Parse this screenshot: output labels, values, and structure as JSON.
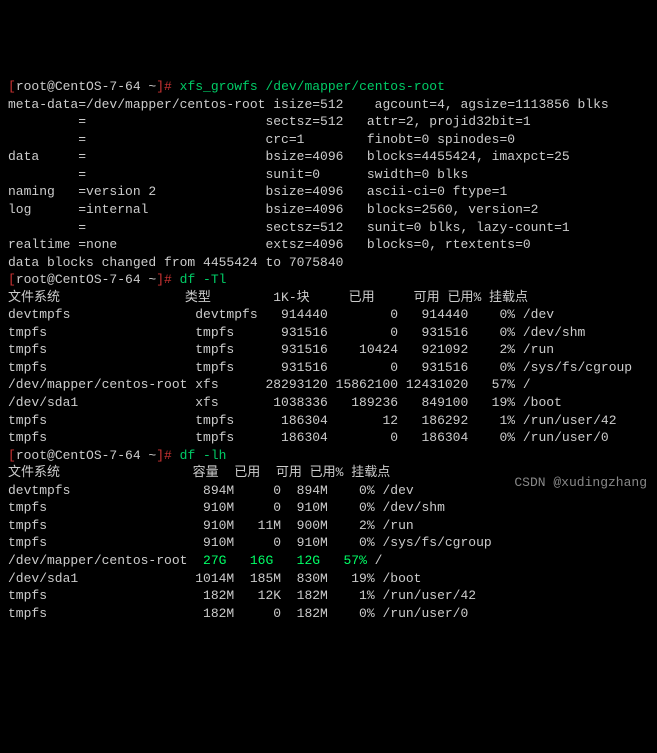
{
  "prompt": {
    "open": "[",
    "user_host": "root@CentOS-7-64 ~",
    "close": "]# "
  },
  "cmd1": "xfs_growfs /dev/mapper/centos-root",
  "xfs_out": "meta-data=/dev/mapper/centos-root isize=512    agcount=4, agsize=1113856 blks\n         =                       sectsz=512   attr=2, projid32bit=1\n         =                       crc=1        finobt=0 spinodes=0\ndata     =                       bsize=4096   blocks=4455424, imaxpct=25\n         =                       sunit=0      swidth=0 blks\nnaming   =version 2              bsize=4096   ascii-ci=0 ftype=1\nlog      =internal               bsize=4096   blocks=2560, version=2\n         =                       sectsz=512   sunit=0 blks, lazy-count=1\nrealtime =none                   extsz=4096   blocks=0, rtextents=0\ndata blocks changed from 4455424 to 7075840",
  "cmd2": "df -Tl",
  "df1_header": "文件系统                类型        1K-块     已用     可用 已用% 挂载点",
  "df1_rows": "devtmpfs                devtmpfs   914440        0   914440    0% /dev\ntmpfs                   tmpfs      931516        0   931516    0% /dev/shm\ntmpfs                   tmpfs      931516    10424   921092    2% /run\ntmpfs                   tmpfs      931516        0   931516    0% /sys/fs/cgroup\n/dev/mapper/centos-root xfs      28293120 15862100 12431020   57% /\n/dev/sda1               xfs       1038336   189236   849100   19% /boot\ntmpfs                   tmpfs      186304       12   186292    1% /run/user/42\ntmpfs                   tmpfs      186304        0   186304    0% /run/user/0",
  "cmd3": "df -lh",
  "df2_header": "文件系统                 容量  已用  可用 已用% 挂载点",
  "df2_pre": "devtmpfs                 894M     0  894M    0% /dev\ntmpfs                    910M     0  910M    0% /dev/shm\ntmpfs                    910M   11M  900M    2% /run\ntmpfs                    910M     0  910M    0% /sys/fs/cgroup",
  "df2_hl_fs": "/dev/mapper/centos-root",
  "df2_hl_size": "  27G   16G   12G   57%",
  "df2_hl_mount": " /",
  "df2_post": "/dev/sda1               1014M  185M  830M   19% /boot\ntmpfs                    182M   12K  182M    1% /run/user/42\ntmpfs                    182M     0  182M    0% /run/user/0",
  "watermark": "CSDN @xudingzhang"
}
